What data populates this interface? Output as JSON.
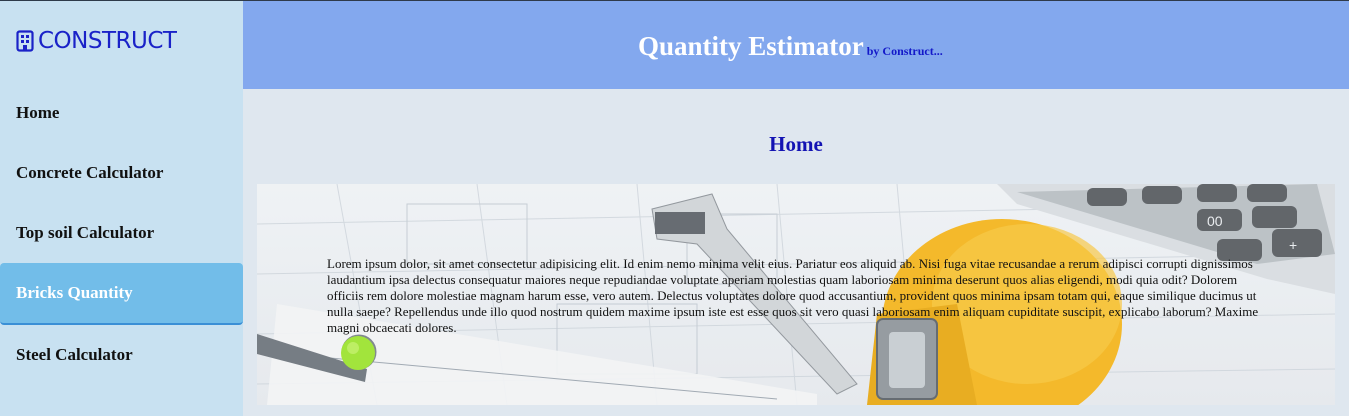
{
  "sidebar": {
    "logo_text": "CONSTRUCT",
    "items": [
      {
        "label": "Home",
        "active": false
      },
      {
        "label": "Concrete Calculator",
        "active": false
      },
      {
        "label": "Top soil Calculator",
        "active": false
      },
      {
        "label": "Bricks Quantity",
        "active": true
      },
      {
        "label": "Steel Calculator",
        "active": false
      }
    ]
  },
  "header": {
    "title": "Quantity Estimator",
    "byline": "by Construct..."
  },
  "main": {
    "page_title": "Home",
    "hero_text": "Lorem ipsum dolor, sit amet consectetur adipisicing elit. Id enim nemo minima velit eius. Pariatur eos aliquid ab. Nisi fuga vitae recusandae a rerum adipisci corrupti dignissimos laudantium ipsa delectus consequatur maiores neque repudiandae voluptate aperiam molestias quam laboriosam minima deserunt quos alias eligendi, modi quia odit? Dolorem officiis rem dolore molestiae magnam harum esse, vero autem. Delectus voluptates dolore quod accusantium, provident quos minima ipsam totam qui, eaque similique ducimus ut nulla saepe? Repellendus unde illo quod nostrum quidem maxime ipsum iste est esse quos sit vero quasi laboriosam enim aliquam cupiditate suscipit, explicabo laborum? Maxime magni obcaecati dolores."
  },
  "colors": {
    "sidebar_bg": "#c8e1f1",
    "header_bg": "#83a8ee",
    "accent": "#1318c9",
    "active_nav": "#72bde9",
    "helmet": "#f4b41a"
  }
}
